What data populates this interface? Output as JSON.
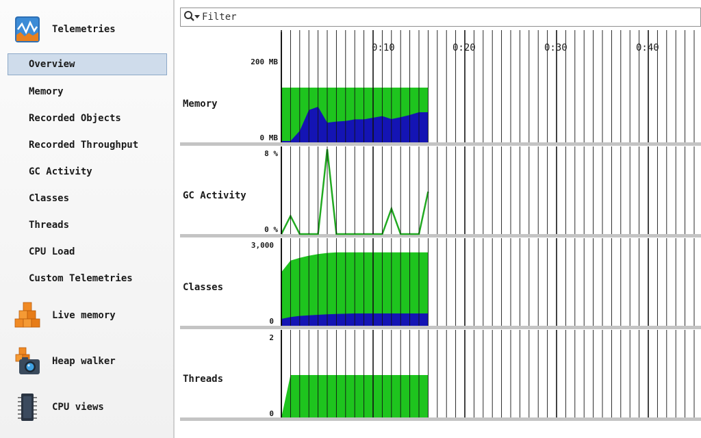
{
  "sidebar": {
    "sections": [
      {
        "label": "Telemetries",
        "icon": "telemetries-icon"
      },
      {
        "label": "Live memory",
        "icon": "live-memory-icon"
      },
      {
        "label": "Heap walker",
        "icon": "heap-walker-icon"
      },
      {
        "label": "CPU views",
        "icon": "cpu-views-icon"
      }
    ],
    "items": [
      {
        "label": "Overview",
        "selected": true
      },
      {
        "label": "Memory"
      },
      {
        "label": "Recorded Objects"
      },
      {
        "label": "Recorded Throughput"
      },
      {
        "label": "GC Activity"
      },
      {
        "label": "Classes"
      },
      {
        "label": "Threads"
      },
      {
        "label": "CPU Load"
      },
      {
        "label": "Custom Telemetries"
      }
    ]
  },
  "filter": {
    "placeholder": "Filter",
    "value": ""
  },
  "timeline": {
    "tick_labels": [
      "0:10",
      "0:20",
      "0:30",
      "0:40"
    ],
    "data_end_seconds": 16
  },
  "colors": {
    "green": "#1ec41e",
    "blue": "#1414b4",
    "line_green": "#22aa22",
    "separator": "#c4c4c4",
    "grid": "#111111"
  },
  "chart_data": [
    {
      "type": "area",
      "title": "Memory",
      "y_max_label": "200 MB",
      "y_min_label": "0 MB",
      "ylim": [
        0,
        200
      ],
      "unit": "MB",
      "x": [
        0,
        1,
        2,
        3,
        4,
        5,
        6,
        7,
        8,
        9,
        10,
        11,
        12,
        13,
        14,
        15,
        16
      ],
      "series": [
        {
          "values": [
            200,
            200,
            200,
            200,
            200,
            200,
            200,
            200,
            200,
            200,
            200,
            200,
            200,
            200,
            200,
            200,
            200
          ]
        },
        {
          "values": [
            5,
            5,
            42,
            118,
            130,
            72,
            76,
            78,
            84,
            84,
            90,
            96,
            85,
            92,
            100,
            110,
            110
          ]
        }
      ]
    },
    {
      "type": "line",
      "title": "GC Activity",
      "y_max_label": "8 %",
      "y_min_label": "0 %",
      "ylim": [
        0,
        8
      ],
      "unit": "%",
      "x": [
        0,
        1,
        2,
        3,
        4,
        5,
        6,
        7,
        8,
        9,
        10,
        11,
        12,
        13,
        14,
        15,
        16
      ],
      "series": [
        {
          "values": [
            0,
            1.7,
            0,
            0,
            0,
            8,
            0,
            0,
            0,
            0,
            0,
            0,
            2.4,
            0,
            0,
            0,
            4
          ]
        }
      ]
    },
    {
      "type": "area",
      "title": "Classes",
      "y_max_label": "3,000",
      "y_min_label": "0",
      "ylim": [
        0,
        3000
      ],
      "x": [
        0,
        1,
        2,
        3,
        4,
        5,
        6,
        7,
        8,
        9,
        10,
        11,
        12,
        13,
        14,
        15,
        16
      ],
      "series": [
        {
          "values": [
            1960,
            2380,
            2480,
            2560,
            2620,
            2660,
            2680,
            2680,
            2680,
            2680,
            2680,
            2680,
            2680,
            2680,
            2680,
            2680,
            2680
          ]
        },
        {
          "values": [
            250,
            320,
            360,
            380,
            400,
            420,
            430,
            440,
            450,
            450,
            450,
            450,
            450,
            450,
            450,
            450,
            450
          ]
        }
      ]
    },
    {
      "type": "area",
      "title": "Threads",
      "y_max_label": "2",
      "y_min_label": "0",
      "ylim": [
        0,
        2
      ],
      "x": [
        0,
        1,
        2,
        3,
        4,
        5,
        6,
        7,
        8,
        9,
        10,
        11,
        12,
        13,
        14,
        15,
        16
      ],
      "series": [
        {
          "values": [
            0,
            1,
            1,
            1,
            1,
            1,
            1,
            1,
            1,
            1,
            1,
            1,
            1,
            1,
            1,
            1,
            1
          ]
        }
      ]
    }
  ]
}
